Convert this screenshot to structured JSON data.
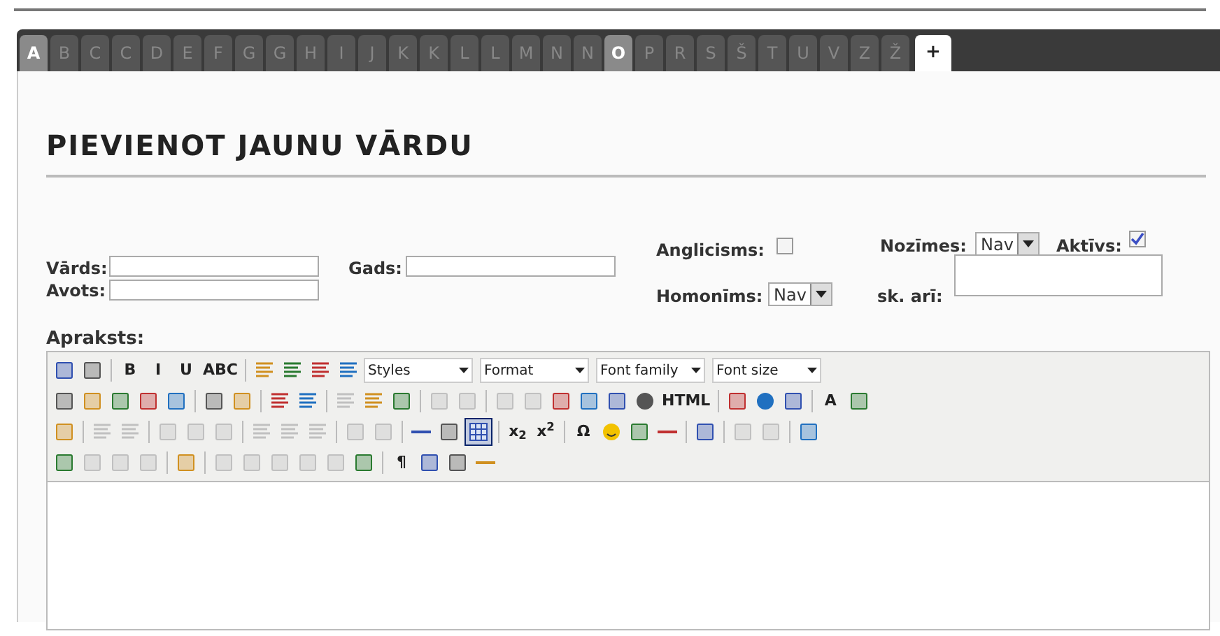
{
  "letter_tabs": [
    {
      "label": "A",
      "selected": true
    },
    {
      "label": "B",
      "selected": false
    },
    {
      "label": "C",
      "selected": false
    },
    {
      "label": "C",
      "selected": false
    },
    {
      "label": "D",
      "selected": false
    },
    {
      "label": "E",
      "selected": false
    },
    {
      "label": "F",
      "selected": false
    },
    {
      "label": "G",
      "selected": false
    },
    {
      "label": "G",
      "selected": false
    },
    {
      "label": "H",
      "selected": false
    },
    {
      "label": "I",
      "selected": false
    },
    {
      "label": "J",
      "selected": false
    },
    {
      "label": "K",
      "selected": false
    },
    {
      "label": "K",
      "selected": false
    },
    {
      "label": "L",
      "selected": false
    },
    {
      "label": "L",
      "selected": false
    },
    {
      "label": "M",
      "selected": false
    },
    {
      "label": "N",
      "selected": false
    },
    {
      "label": "N",
      "selected": false
    },
    {
      "label": "O",
      "selected": true
    },
    {
      "label": "P",
      "selected": false
    },
    {
      "label": "R",
      "selected": false
    },
    {
      "label": "S",
      "selected": false
    },
    {
      "label": "Š",
      "selected": false
    },
    {
      "label": "T",
      "selected": false
    },
    {
      "label": "U",
      "selected": false
    },
    {
      "label": "V",
      "selected": false
    },
    {
      "label": "Z",
      "selected": false
    },
    {
      "label": "Ž",
      "selected": false
    }
  ],
  "add_tab": {
    "label": "+"
  },
  "heading": "PIEVIENOT JAUNU VĀRDU",
  "form": {
    "word_label": "Vārds:",
    "source_label": "Avots:",
    "year_label": "Gads:",
    "anglicism_label": "Anglicisms:",
    "anglicism_checked": false,
    "homonym_label": "Homonīms:",
    "homonym_value": "Nav",
    "meanings_label": "Nozīmes:",
    "meanings_value": "Nav",
    "active_label": "Aktīvs:",
    "active_checked": true,
    "see_also_label": "sk. arī:"
  },
  "description_label": "Apraksts:",
  "toolbar_rows": [
    [
      {
        "kind": "icon",
        "disabled": false
      },
      {
        "kind": "icon",
        "disabled": false
      },
      {
        "kind": "sep"
      },
      {
        "kind": "glyph",
        "text": "B",
        "disabled": false
      },
      {
        "kind": "glyph",
        "text": "I",
        "disabled": false
      },
      {
        "kind": "glyph",
        "text": "U",
        "disabled": false
      },
      {
        "kind": "glyph",
        "text": "ABC",
        "disabled": false
      },
      {
        "kind": "sep"
      },
      {
        "kind": "icon",
        "disabled": false
      },
      {
        "kind": "icon",
        "disabled": false
      },
      {
        "kind": "icon",
        "disabled": false
      },
      {
        "kind": "icon",
        "disabled": false
      },
      {
        "kind": "select",
        "label": "Styles"
      },
      {
        "kind": "select",
        "label": "Format"
      },
      {
        "kind": "select",
        "label": "Font family"
      },
      {
        "kind": "select",
        "label": "Font size"
      }
    ],
    [
      {
        "kind": "icon",
        "disabled": false
      },
      {
        "kind": "icon",
        "disabled": false
      },
      {
        "kind": "icon",
        "disabled": false
      },
      {
        "kind": "icon",
        "disabled": false
      },
      {
        "kind": "icon",
        "disabled": false
      },
      {
        "kind": "sep"
      },
      {
        "kind": "icon",
        "disabled": false
      },
      {
        "kind": "icon",
        "disabled": false
      },
      {
        "kind": "sep"
      },
      {
        "kind": "icon",
        "disabled": false
      },
      {
        "kind": "icon",
        "disabled": false
      },
      {
        "kind": "sep"
      },
      {
        "kind": "icon",
        "disabled": true
      },
      {
        "kind": "icon",
        "disabled": false
      },
      {
        "kind": "icon",
        "disabled": false
      },
      {
        "kind": "sep"
      },
      {
        "kind": "icon",
        "disabled": true
      },
      {
        "kind": "icon",
        "disabled": true
      },
      {
        "kind": "sep"
      },
      {
        "kind": "icon",
        "disabled": true
      },
      {
        "kind": "icon",
        "disabled": true
      },
      {
        "kind": "icon",
        "disabled": false
      },
      {
        "kind": "icon",
        "disabled": false
      },
      {
        "kind": "icon",
        "disabled": false
      },
      {
        "kind": "icon",
        "disabled": false
      },
      {
        "kind": "glyph",
        "text": "HTML",
        "disabled": false
      },
      {
        "kind": "sep"
      },
      {
        "kind": "icon",
        "disabled": false
      },
      {
        "kind": "icon",
        "disabled": false
      },
      {
        "kind": "icon",
        "disabled": false
      },
      {
        "kind": "sep"
      },
      {
        "kind": "glyph",
        "text": "A",
        "disabled": false
      },
      {
        "kind": "icon",
        "disabled": false
      }
    ],
    [
      {
        "kind": "icon",
        "disabled": false
      },
      {
        "kind": "sep"
      },
      {
        "kind": "icon",
        "disabled": true
      },
      {
        "kind": "icon",
        "disabled": true
      },
      {
        "kind": "sep"
      },
      {
        "kind": "icon",
        "disabled": true
      },
      {
        "kind": "icon",
        "disabled": true
      },
      {
        "kind": "icon",
        "disabled": true
      },
      {
        "kind": "sep"
      },
      {
        "kind": "icon",
        "disabled": true
      },
      {
        "kind": "icon",
        "disabled": true
      },
      {
        "kind": "icon",
        "disabled": true
      },
      {
        "kind": "sep"
      },
      {
        "kind": "icon",
        "disabled": true
      },
      {
        "kind": "icon",
        "disabled": true
      },
      {
        "kind": "sep"
      },
      {
        "kind": "icon",
        "disabled": false
      },
      {
        "kind": "icon",
        "disabled": false
      },
      {
        "kind": "toggle",
        "on": true
      },
      {
        "kind": "sep"
      },
      {
        "kind": "glyph",
        "text": "x$_{2}$",
        "disabled": false
      },
      {
        "kind": "glyph",
        "text": "x$^{2}$",
        "disabled": false
      },
      {
        "kind": "sep"
      },
      {
        "kind": "glyph",
        "text": "Ω",
        "disabled": false
      },
      {
        "kind": "icon",
        "disabled": false
      },
      {
        "kind": "icon",
        "disabled": false
      },
      {
        "kind": "icon",
        "disabled": false
      },
      {
        "kind": "sep"
      },
      {
        "kind": "icon",
        "disabled": false
      },
      {
        "kind": "sep"
      },
      {
        "kind": "icon",
        "disabled": true
      },
      {
        "kind": "icon",
        "disabled": true
      },
      {
        "kind": "sep"
      },
      {
        "kind": "icon",
        "disabled": false
      }
    ],
    [
      {
        "kind": "icon",
        "disabled": false
      },
      {
        "kind": "icon",
        "disabled": true
      },
      {
        "kind": "icon",
        "disabled": true
      },
      {
        "kind": "icon",
        "disabled": true
      },
      {
        "kind": "sep"
      },
      {
        "kind": "icon",
        "disabled": false
      },
      {
        "kind": "sep"
      },
      {
        "kind": "icon",
        "disabled": true
      },
      {
        "kind": "icon",
        "disabled": true
      },
      {
        "kind": "icon",
        "disabled": true
      },
      {
        "kind": "icon",
        "disabled": true
      },
      {
        "kind": "icon",
        "disabled": true
      },
      {
        "kind": "icon",
        "disabled": false
      },
      {
        "kind": "sep"
      },
      {
        "kind": "glyph",
        "text": "¶",
        "disabled": false
      },
      {
        "kind": "icon",
        "disabled": false
      },
      {
        "kind": "icon",
        "disabled": false
      },
      {
        "kind": "icon",
        "disabled": false
      }
    ]
  ]
}
